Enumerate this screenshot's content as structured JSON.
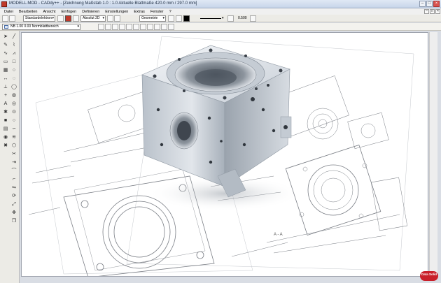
{
  "window": {
    "title": "MODELL.MOD  -  CADdy++  -  [Zeichnung     Maßstab 1.0 : 1.0     Aktuelle Blattmaße 420.0 mm / 297.0 mm]",
    "minimize": "–",
    "maximize": "□",
    "close": "×"
  },
  "menu": [
    "Datei",
    "Bearbeiten",
    "Ansicht",
    "Einfügen",
    "Definieren",
    "Einstellungen",
    "Extras",
    "Fenster",
    "?"
  ],
  "mdi_controls": [
    "–",
    "□",
    "×"
  ],
  "toolbar": {
    "layer_select": "Standardelektron",
    "mode_select": "Absolut 2D",
    "group_select": "Geometrie",
    "size_value": "0.500",
    "accent_color": "#c0392b"
  },
  "sheet": {
    "select_value": "NB 1.00 0.00 Normblattbereich"
  },
  "palette_icons": [
    "arrow-icon",
    "pencil-icon",
    "line-icon",
    "polyline-icon",
    "rectangle-icon",
    "circle-icon",
    "arc-icon",
    "ellipse-icon",
    "curve-icon",
    "hatch-icon",
    "dimension-icon",
    "text-icon",
    "symbol-icon",
    "layer-icon",
    "measure-icon",
    "color-icon",
    "eye-icon",
    "trim-icon",
    "extend-icon",
    "fillet-icon",
    "chamfer-icon",
    "mirror-icon",
    "rotate-icon",
    "scale-icon",
    "move-icon",
    "copy-icon",
    "delete-icon"
  ],
  "logo": {
    "text": "Data Solid"
  }
}
